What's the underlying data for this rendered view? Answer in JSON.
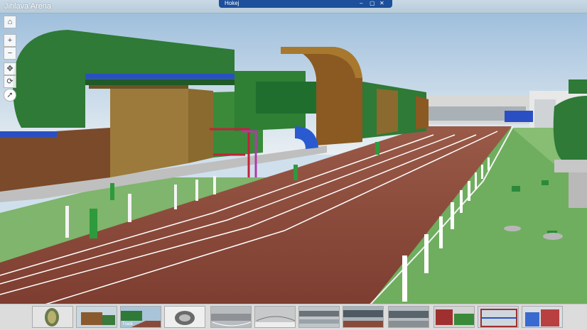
{
  "app": {
    "title": "Jihlava Arena"
  },
  "tab": {
    "label": "Hokej",
    "controls": [
      "–",
      "▢",
      "✕"
    ]
  },
  "nav": {
    "home_icon": "home-icon",
    "zoom_in_icon": "plus-icon",
    "zoom_out_icon": "minus-icon",
    "pan_icon": "move-icon",
    "rotate_icon": "rotate-icon",
    "compass_icon": "compass-icon"
  },
  "filmstrip": {
    "slides": [
      {
        "name": "slide-1",
        "label": ""
      },
      {
        "name": "slide-2",
        "label": ""
      },
      {
        "name": "slide-3",
        "label": "Track"
      },
      {
        "name": "slide-4",
        "label": ""
      },
      {
        "name": "slide-5",
        "label": ""
      },
      {
        "name": "slide-6",
        "label": ""
      },
      {
        "name": "slide-7",
        "label": ""
      },
      {
        "name": "slide-8",
        "label": ""
      },
      {
        "name": "slide-9",
        "label": ""
      },
      {
        "name": "slide-10",
        "label": ""
      },
      {
        "name": "slide-11",
        "label": ""
      },
      {
        "name": "slide-12",
        "label": ""
      }
    ]
  },
  "colors": {
    "sky": "#bcd3e6",
    "track": "#8a4a3a",
    "grass": "#6fae5e",
    "duct_green": "#2e7a36",
    "duct_brown": "#8a6a2e",
    "pipe_blue": "#2a4fc4",
    "tab_blue": "#1d4f9a"
  }
}
